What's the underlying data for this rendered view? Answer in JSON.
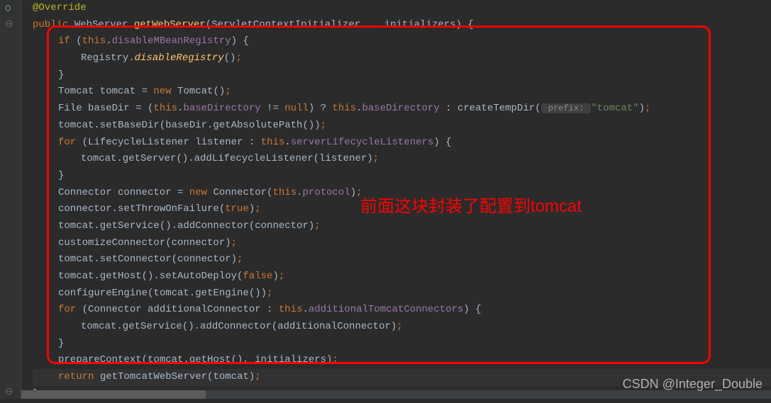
{
  "gutter": {
    "override_icon": "O",
    "collapse_icon": "⊖"
  },
  "code": {
    "l1": {
      "anno": "@Override"
    },
    "l2": {
      "kw_public": "public",
      "type": "WebServer",
      "fn": "getWebServer",
      "params": "(ServletContextInitializer... initializers) {"
    },
    "l3": {
      "kw_if": "if",
      "p1": " (",
      "this": "this",
      "dot": ".",
      "field": "disableMBeanRegistry",
      "p2": ") {"
    },
    "l4": {
      "txt1": "Registry.",
      "fn": "disableRegistry",
      "txt2": "()",
      "semi": ";"
    },
    "l5": {
      "brace": "}"
    },
    "l6": {
      "txt1": "Tomcat tomcat = ",
      "kw_new": "new",
      "txt2": " Tomcat()",
      "semi": ";"
    },
    "l7": {
      "txt1": "File baseDir = (",
      "this1": "this",
      "dot1": ".",
      "f1": "baseDirectory",
      "txt2": " != ",
      "null": "null",
      "txt3": ") ? ",
      "this2": "this",
      "dot2": ".",
      "f2": "baseDirectory",
      "txt4": " : createTempDir(",
      "hint": " prefix: ",
      "str": "\"tomcat\"",
      "txt5": ")",
      "semi": ";"
    },
    "l8": {
      "txt1": "tomcat.setBaseDir(baseDir.getAbsolutePath())",
      "semi": ";"
    },
    "l9": {
      "kw_for": "for",
      "txt1": " (LifecycleListener listener : ",
      "this": "this",
      "dot": ".",
      "field": "serverLifecycleListeners",
      "txt2": ") {"
    },
    "l10": {
      "txt1": "tomcat.getServer().addLifecycleListener(listener)",
      "semi": ";"
    },
    "l11": {
      "brace": "}"
    },
    "l12": {
      "txt1": "Connector connector = ",
      "kw_new": "new",
      "txt2": " Connector(",
      "this": "this",
      "dot": ".",
      "field": "protocol",
      "txt3": ")",
      "semi": ";"
    },
    "l13": {
      "txt1": "connector.setThrowOnFailure(",
      "true": "true",
      "txt2": ")",
      "semi": ";"
    },
    "l14": {
      "txt1": "tomcat.getService().addConnector(connector)",
      "semi": ";"
    },
    "l15": {
      "txt1": "customizeConnector(connector)",
      "semi": ";"
    },
    "l16": {
      "txt1": "tomcat.setConnector(connector)",
      "semi": ";"
    },
    "l17": {
      "txt1": "tomcat.getHost().setAutoDeploy(",
      "false": "false",
      "txt2": ")",
      "semi": ";"
    },
    "l18": {
      "txt1": "configureEngine(tomcat.getEngine())",
      "semi": ";"
    },
    "l19": {
      "kw_for": "for",
      "txt1": " (Connector additionalConnector : ",
      "this": "this",
      "dot": ".",
      "field": "additionalTomcatConnectors",
      "txt2": ") {"
    },
    "l20": {
      "txt1": "tomcat.getService().addConnector(additionalConnector)",
      "semi": ";"
    },
    "l21": {
      "brace": "}"
    },
    "l22": {
      "txt1": "prepareContext(tomcat.getHost(), initializers)",
      "semi": ";"
    },
    "l23": {
      "kw_return": "return",
      "txt1": " getTomcatWebServer(tomcat)",
      "semi": ";"
    },
    "l24": {
      "brace": "}"
    }
  },
  "annotation_text": "前面这块封装了配置到tomcat",
  "watermark_text": "CSDN @Integer_Double"
}
